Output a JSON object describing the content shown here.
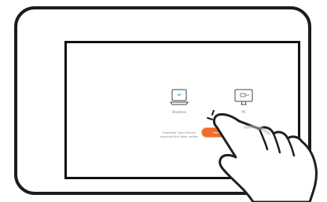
{
  "colors": {
    "frame": "#1c1c1c",
    "screen_border": "#111111",
    "accent": "#f26b2a",
    "text": "#7b7b7b"
  },
  "screen": {
    "options": [
      {
        "label": "Drowlens",
        "icon": "laptop-icon"
      },
      {
        "label": "PC",
        "icon": "monitor-icon"
      }
    ],
    "download": {
      "line1": "Download Open Process",
      "line2": "download the latest update"
    },
    "action_button_label": "Start process"
  },
  "pointer": {
    "icon": "pointing-hand-icon"
  }
}
